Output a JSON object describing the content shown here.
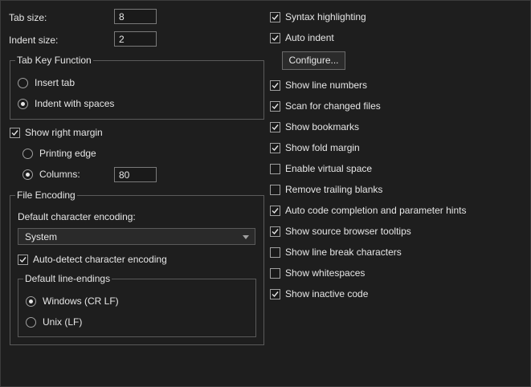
{
  "tab_size": {
    "label": "Tab size:",
    "value": "8"
  },
  "indent_size": {
    "label": "Indent size:",
    "value": "2"
  },
  "tab_key_function": {
    "title": "Tab Key Function",
    "insert_tab": "Insert tab",
    "indent_with_spaces": "Indent with spaces",
    "selected": "indent_with_spaces"
  },
  "right_margin": {
    "show_label": "Show right margin",
    "checked": true,
    "printing_edge": "Printing edge",
    "columns_label": "Columns:",
    "columns_value": "80",
    "selected": "columns"
  },
  "file_encoding": {
    "title": "File Encoding",
    "default_label": "Default character encoding:",
    "selected_value": "System",
    "auto_detect": "Auto-detect character encoding",
    "auto_detect_checked": true,
    "line_endings_title": "Default line-endings",
    "windows": "Windows (CR LF)",
    "unix": "Unix (LF)",
    "selected_line_ending": "windows"
  },
  "options": {
    "syntax_highlighting": {
      "label": "Syntax highlighting",
      "checked": true
    },
    "auto_indent": {
      "label": "Auto indent",
      "checked": true
    },
    "configure_button": "Configure...",
    "show_line_numbers": {
      "label": "Show line numbers",
      "checked": true
    },
    "scan_changed_files": {
      "label": "Scan for changed files",
      "checked": true
    },
    "show_bookmarks": {
      "label": "Show bookmarks",
      "checked": true
    },
    "show_fold_margin": {
      "label": "Show fold margin",
      "checked": true
    },
    "enable_virtual_space": {
      "label": "Enable virtual space",
      "checked": false
    },
    "remove_trailing_blanks": {
      "label": "Remove trailing blanks",
      "checked": false
    },
    "auto_code_completion": {
      "label": "Auto code completion and parameter hints",
      "checked": true
    },
    "source_browser_tooltips": {
      "label": "Show source browser tooltips",
      "checked": true
    },
    "line_break_characters": {
      "label": "Show line break characters",
      "checked": false
    },
    "show_whitespaces": {
      "label": "Show whitespaces",
      "checked": false
    },
    "show_inactive_code": {
      "label": "Show inactive code",
      "checked": true
    }
  },
  "icons": {
    "check": "checkmark-icon",
    "dropdown": "chevron-down-icon"
  },
  "colors": {
    "background": "#1e1e1e",
    "text": "#e6e6e6",
    "border": "#5a5a5a"
  }
}
